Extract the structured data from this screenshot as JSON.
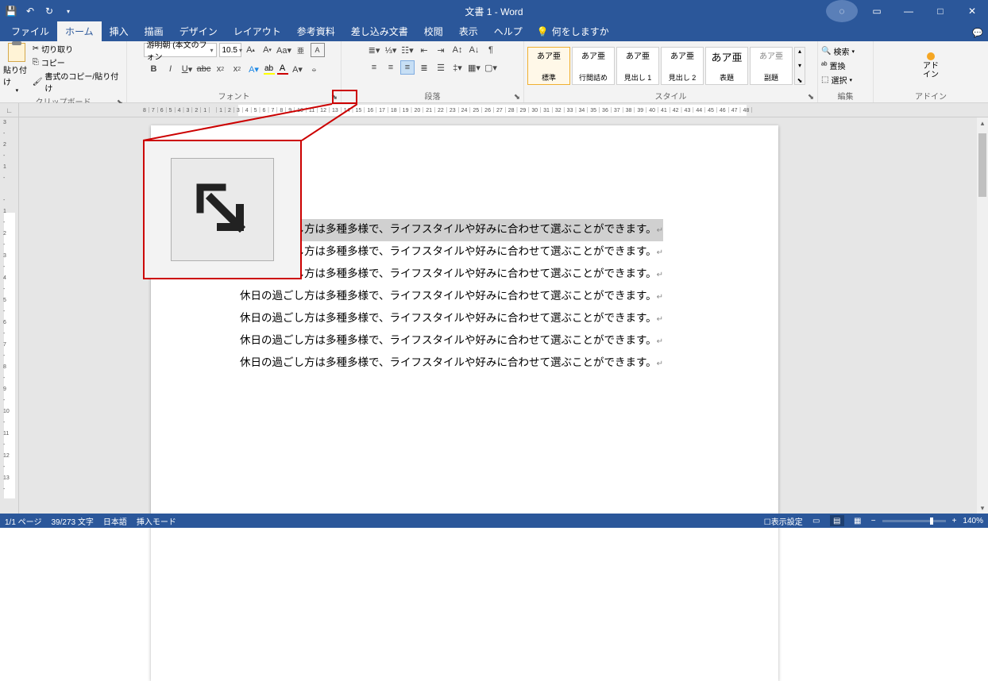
{
  "title": "文書 1 - Word",
  "qat": {
    "save": "save-icon",
    "undo": "undo-icon",
    "redo": "redo-icon"
  },
  "tabs": {
    "items": [
      "ファイル",
      "ホーム",
      "挿入",
      "描画",
      "デザイン",
      "レイアウト",
      "参考資料",
      "差し込み文書",
      "校閲",
      "表示",
      "ヘルプ"
    ],
    "active": 1,
    "tell_me": "何をしますか"
  },
  "ribbon": {
    "clipboard": {
      "label": "クリップボード",
      "paste": "貼り付け",
      "cut": "切り取り",
      "copy": "コピー",
      "format_painter": "書式のコピー/貼り付け"
    },
    "font": {
      "label": "フォント",
      "name": "游明朝 (本文のフォン",
      "size": "10.5"
    },
    "paragraph": {
      "label": "段落"
    },
    "styles": {
      "label": "スタイル",
      "sample": "あア亜",
      "big_sample": "あア亜",
      "items": [
        "標準",
        "行間詰め",
        "見出し 1",
        "見出し 2",
        "表題",
        "副題"
      ]
    },
    "edit": {
      "label": "編集",
      "find": "検索",
      "replace": "置換",
      "select": "選択"
    },
    "addin": {
      "label": "アドイン",
      "btn": "アド\nイン"
    }
  },
  "hruler_marks": "8｜7｜6｜5｜4｜3｜2｜1｜    ｜1｜2｜3｜4｜5｜6｜7｜8｜9｜10｜11｜12｜13｜14｜15｜16｜17｜18｜19｜20｜21｜22｜23｜24｜25｜26｜27｜28｜29｜30｜31｜32｜33｜34｜35｜36｜37｜38｜39｜40｜41｜42｜43｜44｜45｜46｜47｜48｜",
  "vruler_marks": "3\n-\n2\n-\n1\n-\n\n-\n1\n-\n2\n-\n3\n-\n4\n-\n5\n-\n6\n-\n7\n-\n8\n-\n9\n-\n10\n-\n11\n-\n12\n-\n13\n-",
  "document": {
    "lines": [
      "休日の過ごし方は多種多様で、ライフスタイルや好みに合わせて選ぶことができます。",
      "休日の過ごし方は多種多様で、ライフスタイルや好みに合わせて選ぶことができます。",
      "休日の過ごし方は多種多様で、ライフスタイルや好みに合わせて選ぶことができます。",
      "休日の過ごし方は多種多様で、ライフスタイルや好みに合わせて選ぶことができます。",
      "休日の過ごし方は多種多様で、ライフスタイルや好みに合わせて選ぶことができます。",
      "休日の過ごし方は多種多様で、ライフスタイルや好みに合わせて選ぶことができます。",
      "休日の過ごし方は多種多様で、ライフスタイルや好みに合わせて選ぶことができます。"
    ]
  },
  "statusbar": {
    "page": "1/1 ページ",
    "words": "39/273 文字",
    "lang": "日本語",
    "mode": "挿入モード",
    "display": "表示設定",
    "zoom": "140%"
  }
}
